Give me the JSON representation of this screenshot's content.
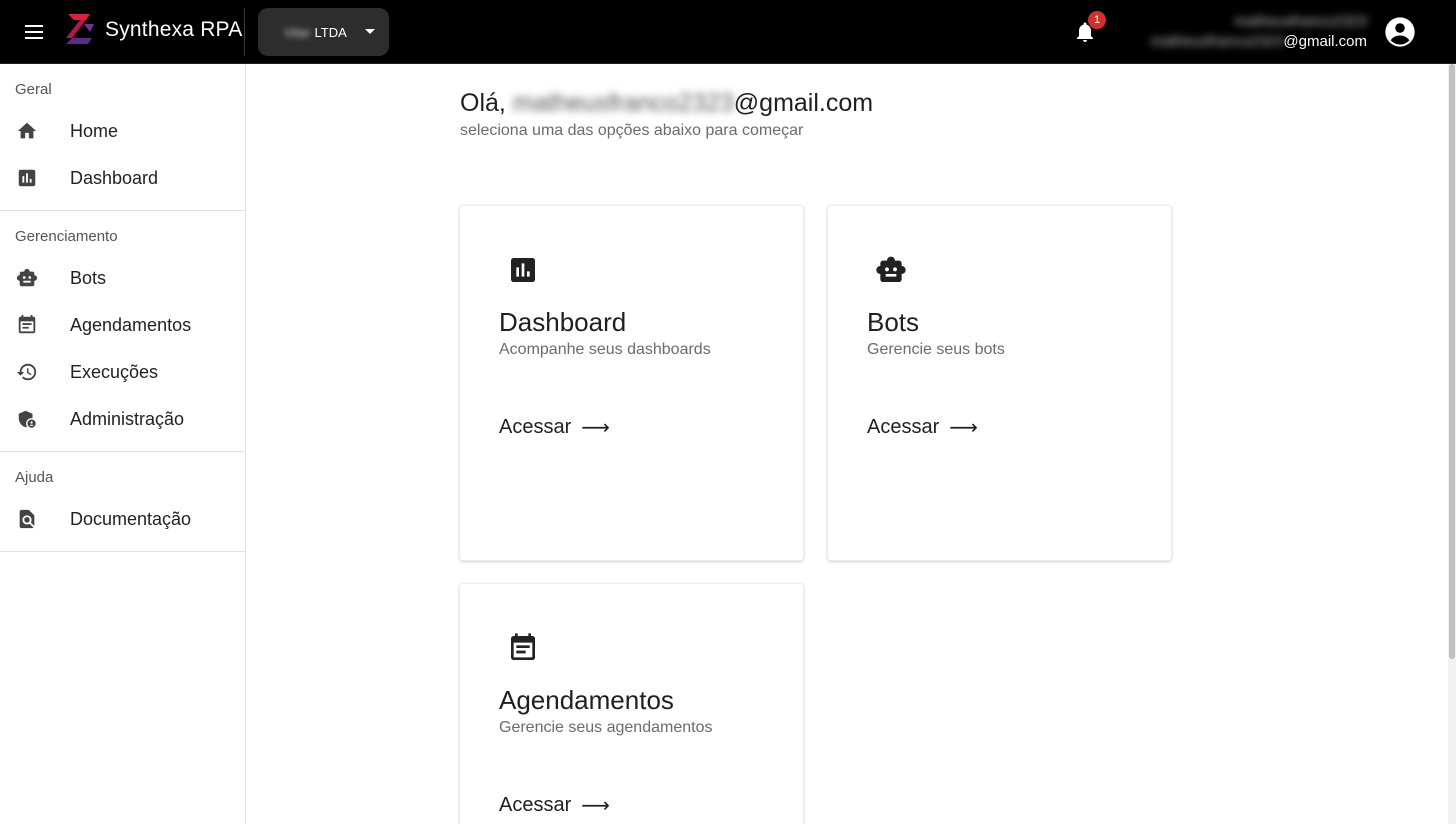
{
  "header": {
    "app_title": "Synthexa RPA",
    "org_select": {
      "blurred_prefix": "Vitar",
      "value": "LTDA"
    },
    "notifications_count": "1",
    "user": {
      "name_blurred": "matheusfranco2323",
      "email_blurred": "matheusfranco2323",
      "email_domain": "@gmail.com"
    }
  },
  "sidebar": {
    "sections": [
      {
        "title": "Geral",
        "items": [
          {
            "label": "Home",
            "icon": "home-icon"
          },
          {
            "label": "Dashboard",
            "icon": "bar-chart-icon"
          }
        ]
      },
      {
        "title": "Gerenciamento",
        "items": [
          {
            "label": "Bots",
            "icon": "robot-icon"
          },
          {
            "label": "Agendamentos",
            "icon": "calendar-icon"
          },
          {
            "label": "Execuções",
            "icon": "history-icon"
          },
          {
            "label": "Administração",
            "icon": "shield-user-icon"
          }
        ]
      },
      {
        "title": "Ajuda",
        "items": [
          {
            "label": "Documentação",
            "icon": "search-document-icon"
          }
        ]
      }
    ]
  },
  "main": {
    "greeting_prefix": "Olá,",
    "greeting_blurred": "matheusfranco2323",
    "greeting_domain": "@gmail.com",
    "subtitle": "seleciona uma das opções abaixo para começar",
    "cards": [
      {
        "title": "Dashboard",
        "description": "Acompanhe seus dashboards",
        "action": "Acessar",
        "icon": "bar-chart-icon"
      },
      {
        "title": "Bots",
        "description": "Gerencie seus bots",
        "action": "Acessar",
        "icon": "robot-icon"
      },
      {
        "title": "Agendamentos",
        "description": "Gerencie seus agendamentos",
        "action": "Acessar",
        "icon": "calendar-icon"
      }
    ]
  },
  "colors": {
    "topbar": "#000000",
    "badge": "#d32f2f",
    "logo_red": "#e0203a",
    "logo_purple": "#5b2a86"
  }
}
